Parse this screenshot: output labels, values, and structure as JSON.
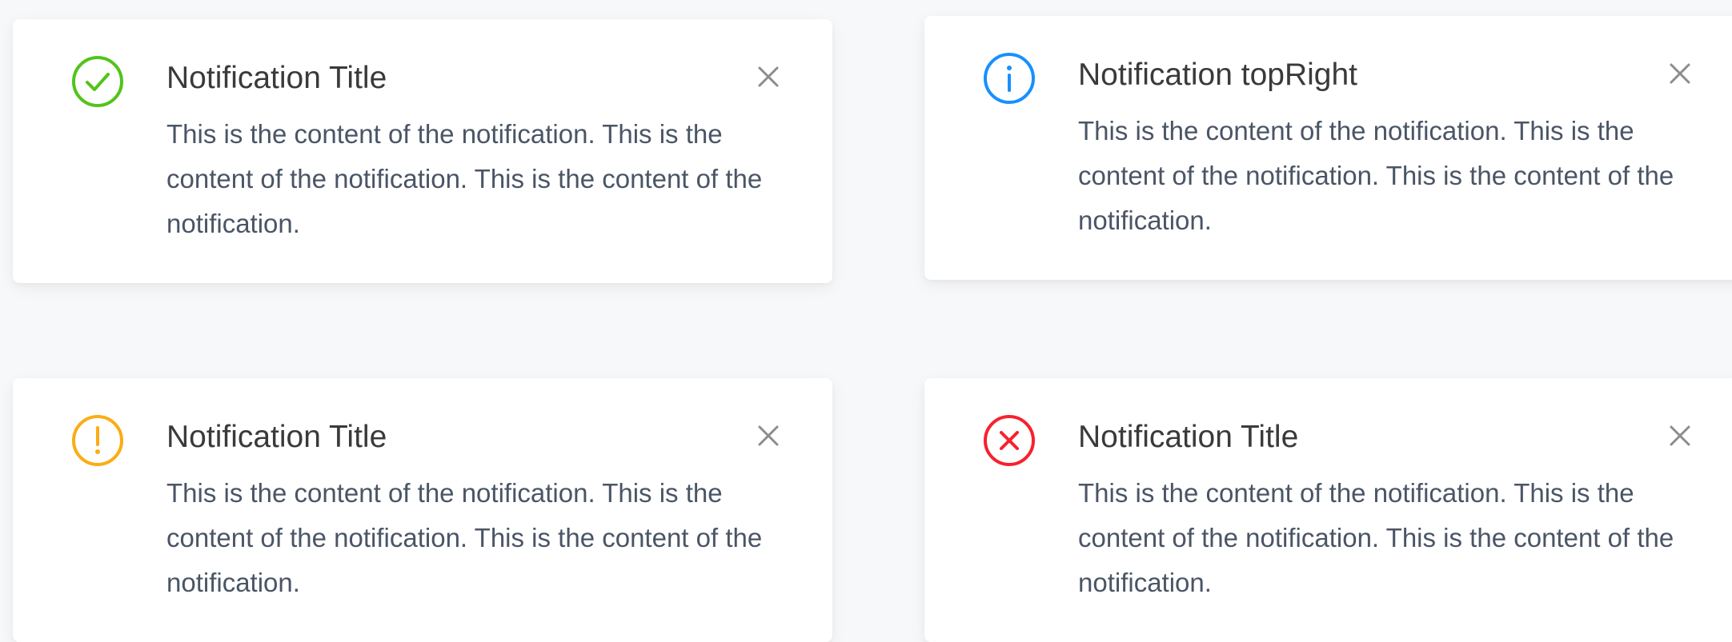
{
  "notifications": [
    {
      "type": "success",
      "icon": "check-circle-icon",
      "color": "#52c41a",
      "title": "Notification Title",
      "content": "This is the content of the notification. This is the content of the notification. This is the content of the notification."
    },
    {
      "type": "info",
      "icon": "info-circle-icon",
      "color": "#1890ff",
      "title": "Notification topRight",
      "content": "This is the content of the notification. This is the content of the notification. This is the content of the notification."
    },
    {
      "type": "warning",
      "icon": "exclamation-circle-icon",
      "color": "#faad14",
      "title": "Notification Title",
      "content": "This is the content of the notification. This is the content of the notification. This is the content of the notification."
    },
    {
      "type": "error",
      "icon": "close-circle-icon",
      "color": "#f5222d",
      "title": "Notification Title",
      "content": "This is the content of the notification. This is the content of the notification. This is the content of the notification."
    }
  ],
  "close_icon": "close-icon"
}
